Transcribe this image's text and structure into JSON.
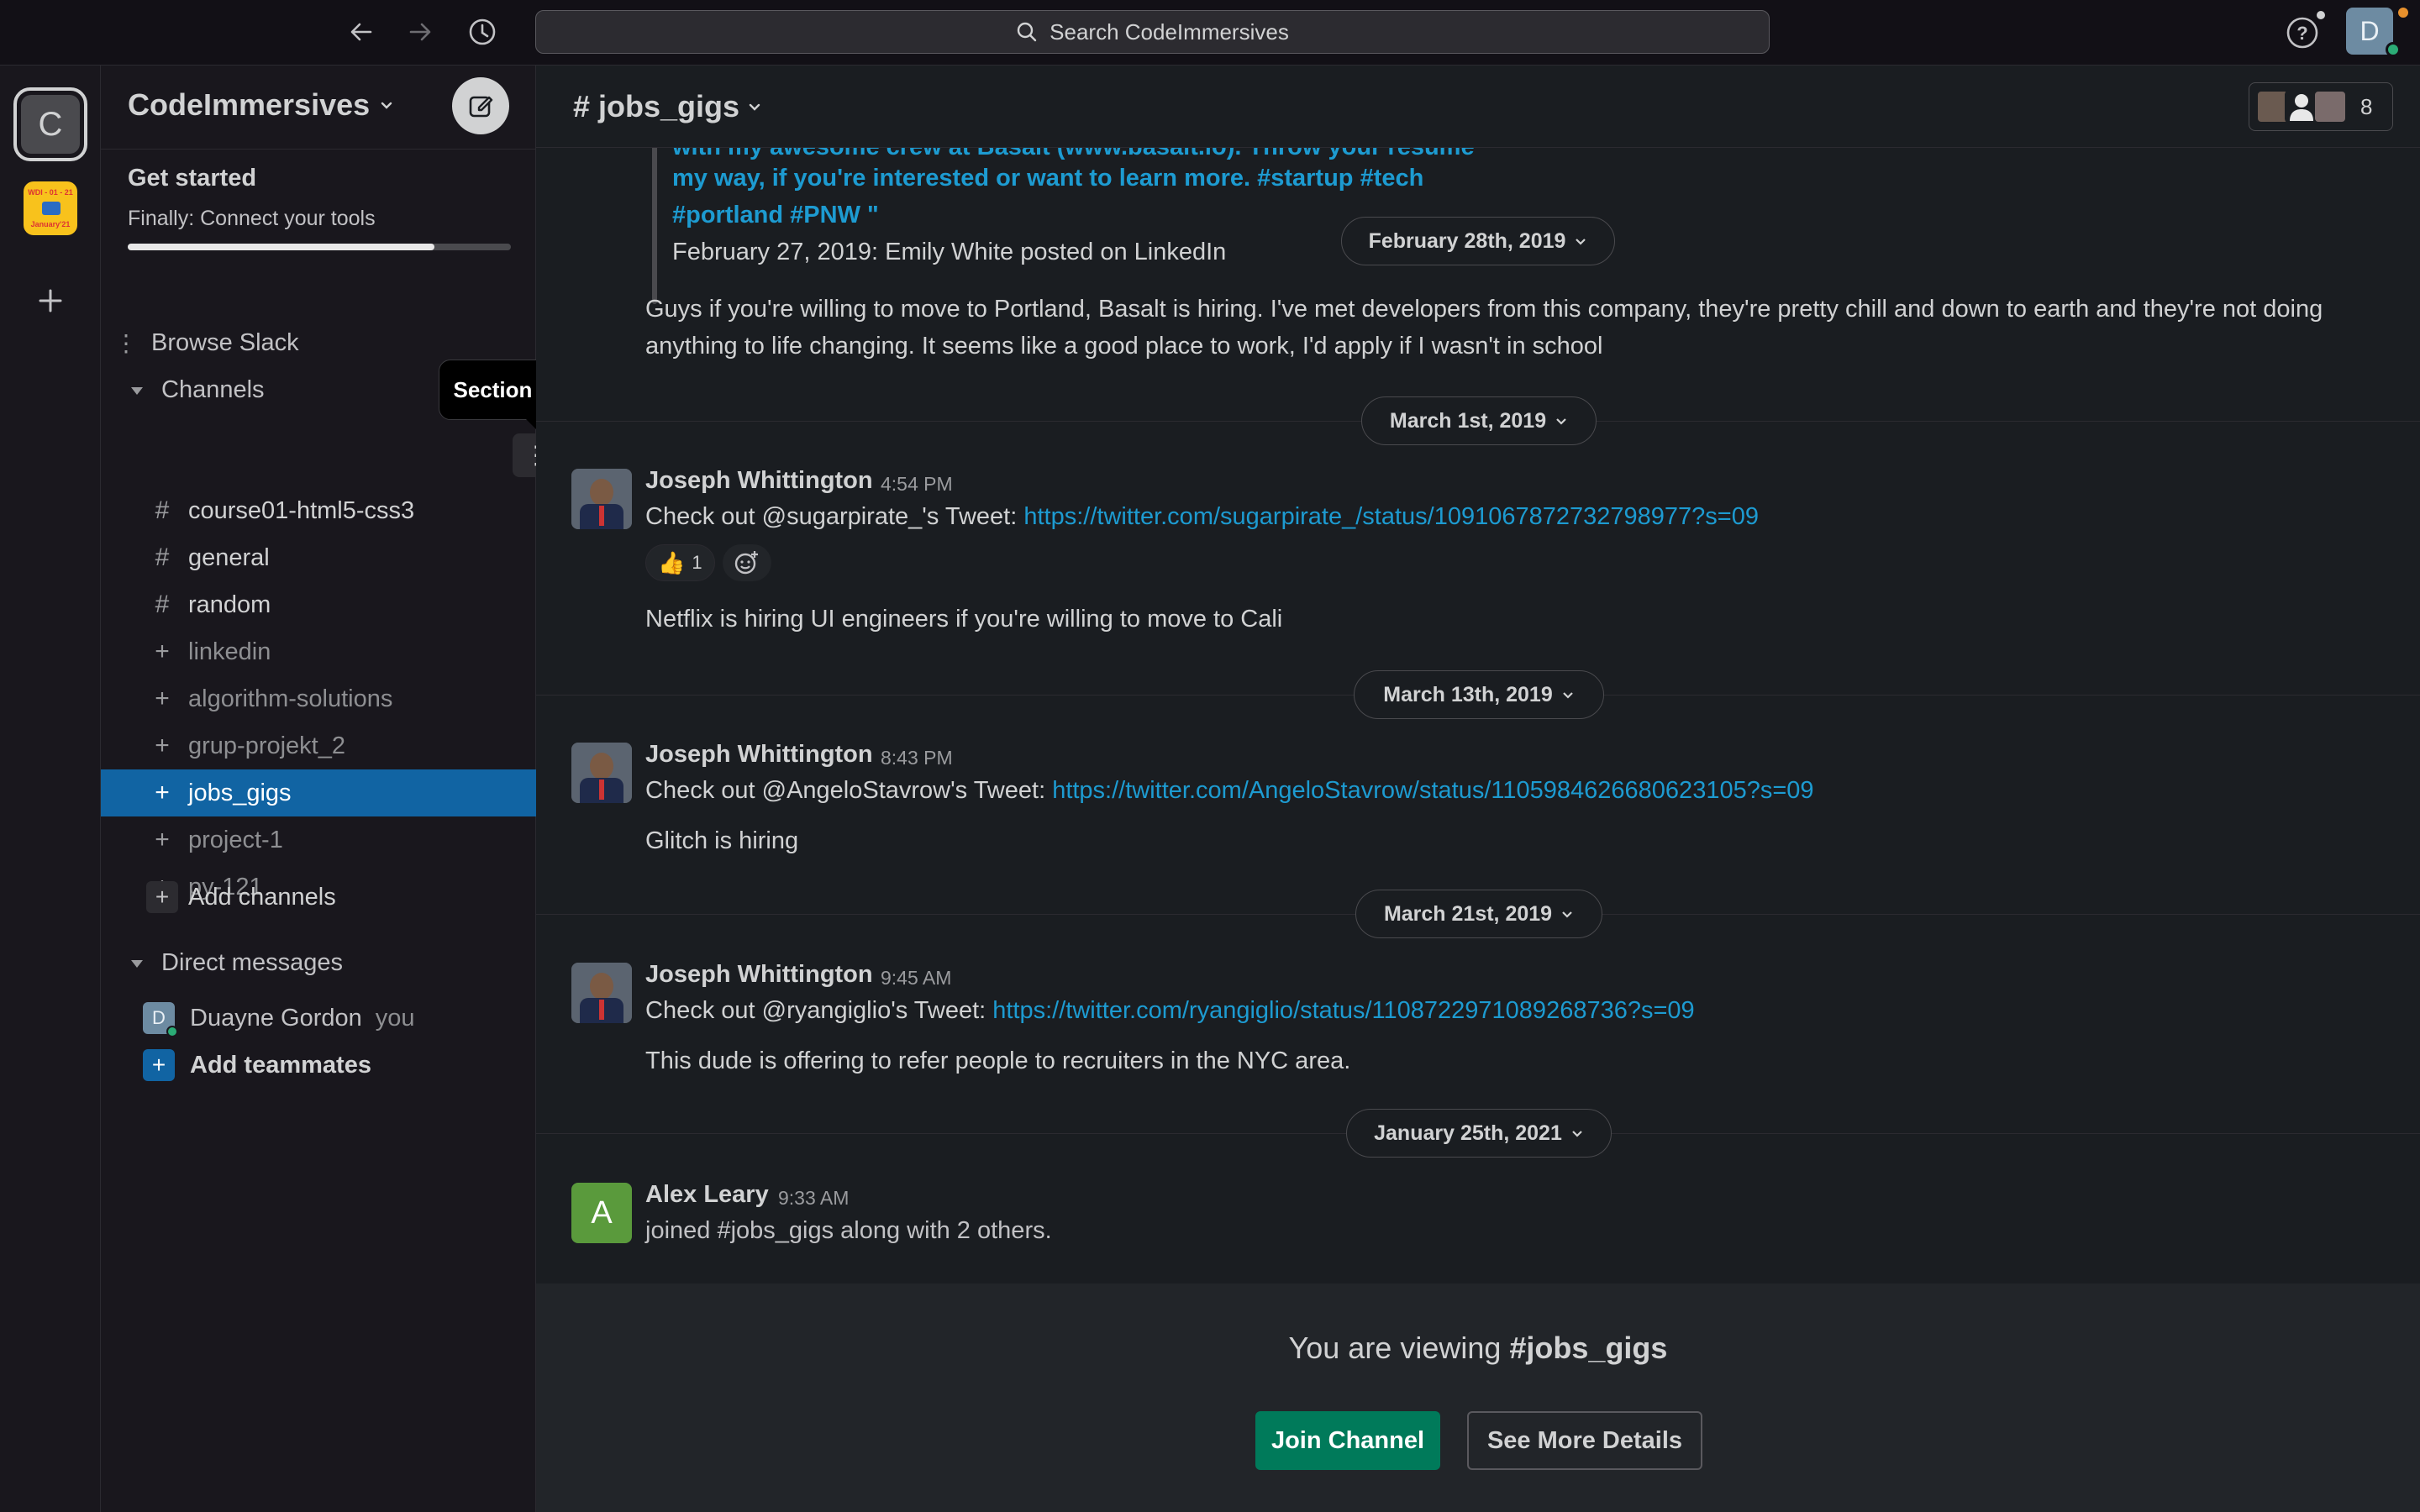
{
  "search": {
    "placeholder": "Search CodeImmersives"
  },
  "rail": {
    "workspace_letter": "C",
    "second_ws_line1": "WDI - 01 - 21",
    "second_ws_line2": "January'21"
  },
  "user": {
    "avatar_letter": "D"
  },
  "sidebar": {
    "workspace_name": "CodeImmersives",
    "get_started_title": "Get started",
    "get_started_sub": "Finally: Connect your tools",
    "get_started_progress": 0.8,
    "browse": "Browse Slack",
    "tooltip": "Section options",
    "channels_header": "Channels",
    "channels": [
      {
        "icon": "#",
        "label": "course01-html5-css3"
      },
      {
        "icon": "#",
        "label": "general"
      },
      {
        "icon": "#",
        "label": "random"
      },
      {
        "icon": "+",
        "label": "linkedin"
      },
      {
        "icon": "+",
        "label": "algorithm-solutions"
      },
      {
        "icon": "+",
        "label": "grup-projekt_2"
      },
      {
        "icon": "+",
        "label": "jobs_gigs"
      },
      {
        "icon": "+",
        "label": "project-1"
      },
      {
        "icon": "+",
        "label": "py-121"
      }
    ],
    "add_channels": "Add channels",
    "dm_header": "Direct messages",
    "dm_user": "Duayne Gordon",
    "dm_you": "you",
    "dm_avatar": "D",
    "add_teammates": "Add teammates"
  },
  "channel": {
    "title": "# jobs_gigs",
    "member_count": "8"
  },
  "messages": {
    "quote_line1": "with my awesome crew at Basalt (www.basalt.io). Throw your resume",
    "quote_line2": "my way, if you're interested or want to learn more. #startup #tech",
    "quote_line3": "#portland #PNW \"",
    "quote_source": "February 27, 2019: Emily White posted on LinkedIn",
    "date1": "February 28th, 2019",
    "body1": "Guys if you're willing to move to Portland, Basalt is hiring. I've met developers from this company, they're pretty chill and down to earth and they're not doing anything to life changing. It seems like a good place to work, I'd apply if I wasn't in school",
    "date2": "March 1st, 2019",
    "m1_user": "Joseph Whittington",
    "m1_time": "4:54 PM",
    "m1_text": "Check out @sugarpirate_'s Tweet: ",
    "m1_link": "https://twitter.com/sugarpirate_/status/1091067872732798977?s=09",
    "m1_reaction_count": "1",
    "m1_text2": "Netflix is hiring UI engineers if you're willing to move to Cali",
    "date3": "March 13th, 2019",
    "m2_user": "Joseph Whittington",
    "m2_time": "8:43 PM",
    "m2_text": "Check out @AngeloStavrow's Tweet: ",
    "m2_link": "https://twitter.com/AngeloStavrow/status/1105984626680623105?s=09",
    "m2_text2": "Glitch is hiring",
    "date4": "March 21st, 2019",
    "m3_user": "Joseph Whittington",
    "m3_time": "9:45 AM",
    "m3_text": "Check out @ryangiglio's Tweet: ",
    "m3_link": "https://twitter.com/ryangiglio/status/1108722971089268736?s=09",
    "m3_text2": "This dude is offering to refer people to recruiters in the NYC area.",
    "date5": "January 25th, 2021",
    "m4_avatar": "A",
    "m4_user": "Alex Leary",
    "m4_time": "9:33 AM",
    "m4_text": "joined #jobs_gigs along with 2 others."
  },
  "footer": {
    "viewing_prefix": "You are viewing",
    "viewing_channel": "#jobs_gigs",
    "join": "Join Channel",
    "details": "See More Details"
  }
}
